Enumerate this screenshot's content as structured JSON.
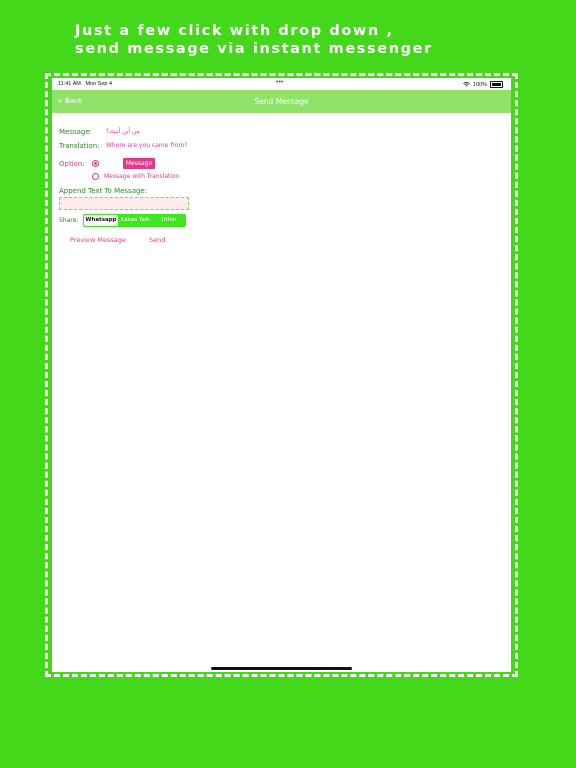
{
  "headline": {
    "line1": "Just a few click with drop down ,",
    "line2": "send message via instant messenger"
  },
  "statusbar": {
    "time": "11:41 AM",
    "date": "Mon Sep 4",
    "dots": "•••",
    "battery": "100%"
  },
  "navbar": {
    "back": "< Back",
    "title": "Send Message"
  },
  "form": {
    "message_label": "Message:",
    "message_value": "مِن أين أتيتَ؟",
    "translation_label": "Translation:",
    "translation_value": "Where are you came from?",
    "option_label": "Option:",
    "option_message": "Message",
    "option_translation": "Message with Translation",
    "append_label": "Append Text To Message:",
    "append_value": "",
    "share_label": "Share:",
    "share_options": [
      "Whatsapp",
      "Kakao Talk",
      "Other"
    ],
    "preview_button": "Preview Message",
    "send_button": "Send"
  },
  "colors": {
    "background": "#44d81a",
    "navbar": "#8fe36b",
    "accent_pink": "#e13a8a",
    "label_green": "#2b8a1f"
  }
}
